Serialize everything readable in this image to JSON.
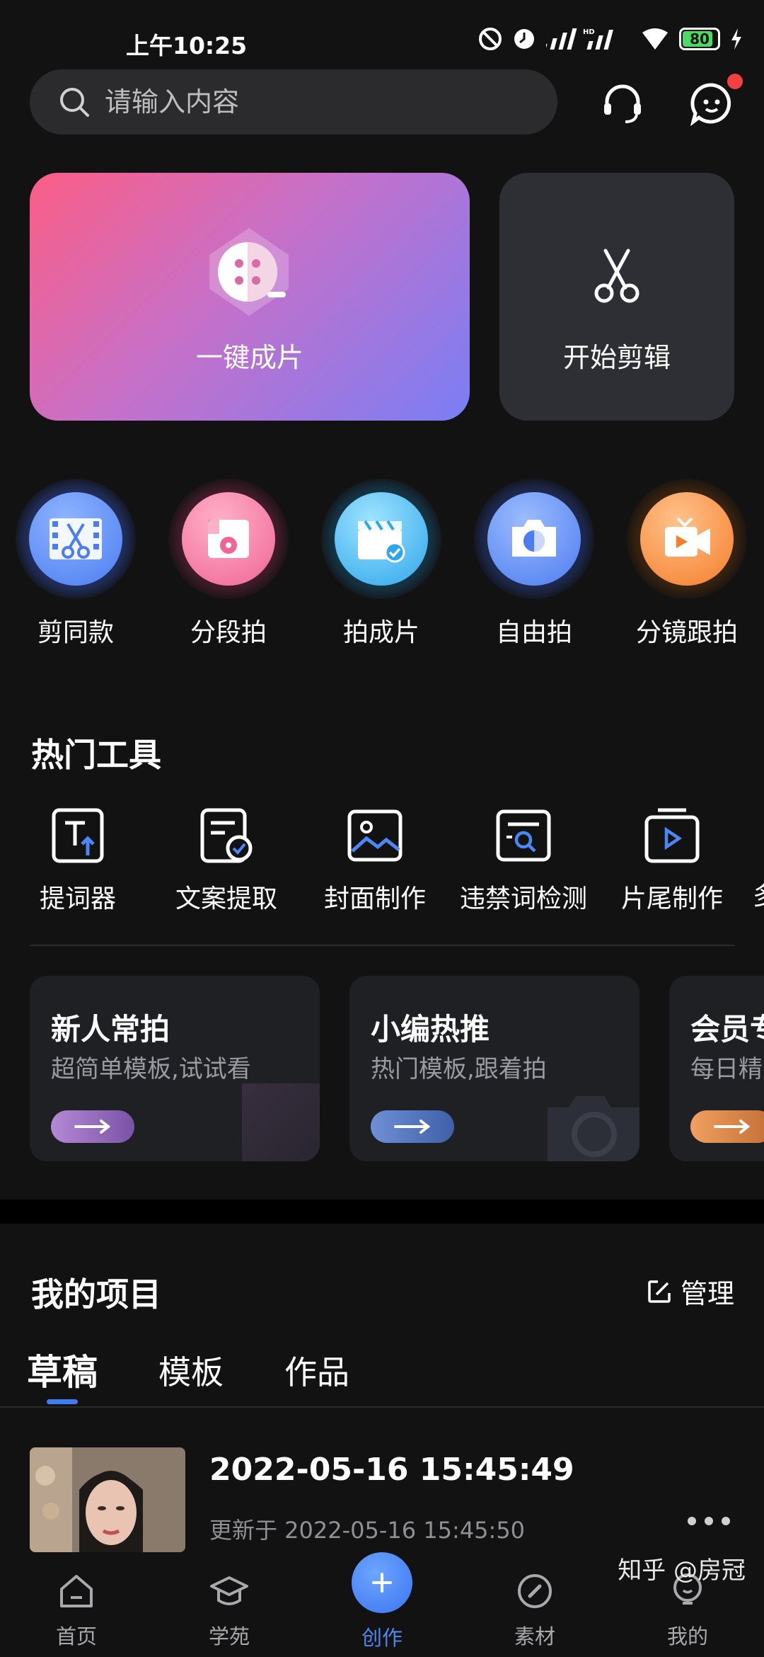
{
  "status_bar": {
    "time": "上午10:25",
    "battery": "80"
  },
  "search": {
    "placeholder": "请输入内容"
  },
  "hero": {
    "one_click_label": "一键成片",
    "start_edit_label": "开始剪辑"
  },
  "shortcuts": [
    {
      "label": "剪同款",
      "icon": "film-scissors-icon",
      "color": "#5b8ef5"
    },
    {
      "label": "分段拍",
      "icon": "segment-record-icon",
      "color": "#f36f97"
    },
    {
      "label": "拍成片",
      "icon": "clapperboard-icon",
      "color": "#36b3f0"
    },
    {
      "label": "自由拍",
      "icon": "camera-icon",
      "color": "#5b8ef5"
    },
    {
      "label": "分镜跟拍",
      "icon": "video-camera-icon",
      "color": "#f78c3c"
    }
  ],
  "hot_tools": {
    "title": "热门工具",
    "items": [
      {
        "label": "提词器",
        "icon": "teleprompter-icon"
      },
      {
        "label": "文案提取",
        "icon": "text-extract-icon"
      },
      {
        "label": "封面制作",
        "icon": "image-icon"
      },
      {
        "label": "违禁词检测",
        "icon": "text-search-icon"
      },
      {
        "label": "片尾制作",
        "icon": "play-frame-icon"
      },
      {
        "label": "多",
        "icon": "more-tools-icon"
      }
    ]
  },
  "promos": [
    {
      "title": "新人常拍",
      "subtitle": "超简单模板,试试看",
      "pill_color": "#8e5fb5"
    },
    {
      "title": "小编热推",
      "subtitle": "热门模板,跟着拍",
      "pill_color": "#3f5fa8"
    },
    {
      "title": "会员专",
      "subtitle": "每日精",
      "pill_color": "#c26d35"
    }
  ],
  "projects": {
    "title": "我的项目",
    "manage_label": "管理",
    "tabs": [
      "草稿",
      "模板",
      "作品"
    ],
    "active_tab": "草稿",
    "items": [
      {
        "title": "2022-05-16 15:45:49",
        "updated": "更新于 2022-05-16 15:45:50"
      }
    ]
  },
  "bottom_nav": {
    "items": [
      {
        "label": "首页",
        "icon": "home-icon"
      },
      {
        "label": "学苑",
        "icon": "graduation-cap-icon"
      },
      {
        "label": "创作",
        "icon": "plus-icon",
        "active": true
      },
      {
        "label": "素材",
        "icon": "compass-icon"
      },
      {
        "label": "我的",
        "icon": "profile-icon"
      }
    ]
  },
  "watermark": "知乎 @房冠"
}
